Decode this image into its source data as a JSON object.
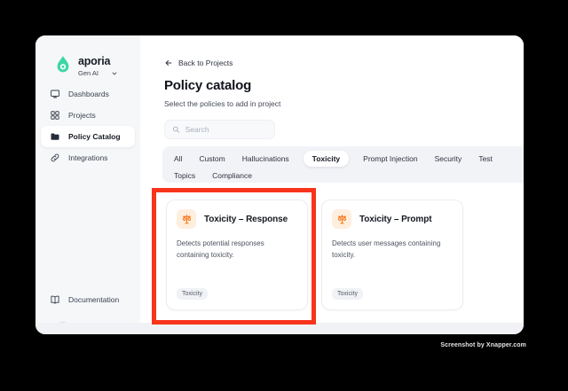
{
  "brand": {
    "name": "aporia",
    "workspace": "Gen AI"
  },
  "sidebar": {
    "items": [
      {
        "label": "Dashboards",
        "selected": false
      },
      {
        "label": "Projects",
        "selected": false
      },
      {
        "label": "Policy Catalog",
        "selected": true
      },
      {
        "label": "Integrations",
        "selected": false
      }
    ],
    "documentation_label": "Documentation"
  },
  "main": {
    "back_link": "Back to Projects",
    "title": "Policy catalog",
    "subtitle": "Select the policies to add in project",
    "search": {
      "placeholder": "Search"
    },
    "tabs": [
      {
        "label": "All",
        "selected": false
      },
      {
        "label": "Custom",
        "selected": false
      },
      {
        "label": "Hallucinations",
        "selected": false
      },
      {
        "label": "Toxicity",
        "selected": true
      },
      {
        "label": "Prompt Injection",
        "selected": false
      },
      {
        "label": "Security",
        "selected": false
      },
      {
        "label": "Test",
        "selected": false
      },
      {
        "label": "Topics",
        "selected": false
      },
      {
        "label": "Compliance",
        "selected": false
      }
    ],
    "cards": [
      {
        "title": "Toxicity – Response",
        "description": "Detects potential responses containing toxicity.",
        "tag": "Toxicity",
        "highlighted": true
      },
      {
        "title": "Toxicity – Prompt",
        "description": "Detects user messages containing toxicity.",
        "tag": "Toxicity",
        "highlighted": false
      }
    ]
  },
  "watermark": "Screenshot by Xnapper.com",
  "colors": {
    "accent_teal": "#3ed6a4",
    "icon_orange": "#f97316",
    "icon_orange_bg": "#fdeede",
    "highlight_red": "#f8341c",
    "sidebar_bg": "#f6f7f9",
    "tabs_bg": "#f2f3f7"
  }
}
